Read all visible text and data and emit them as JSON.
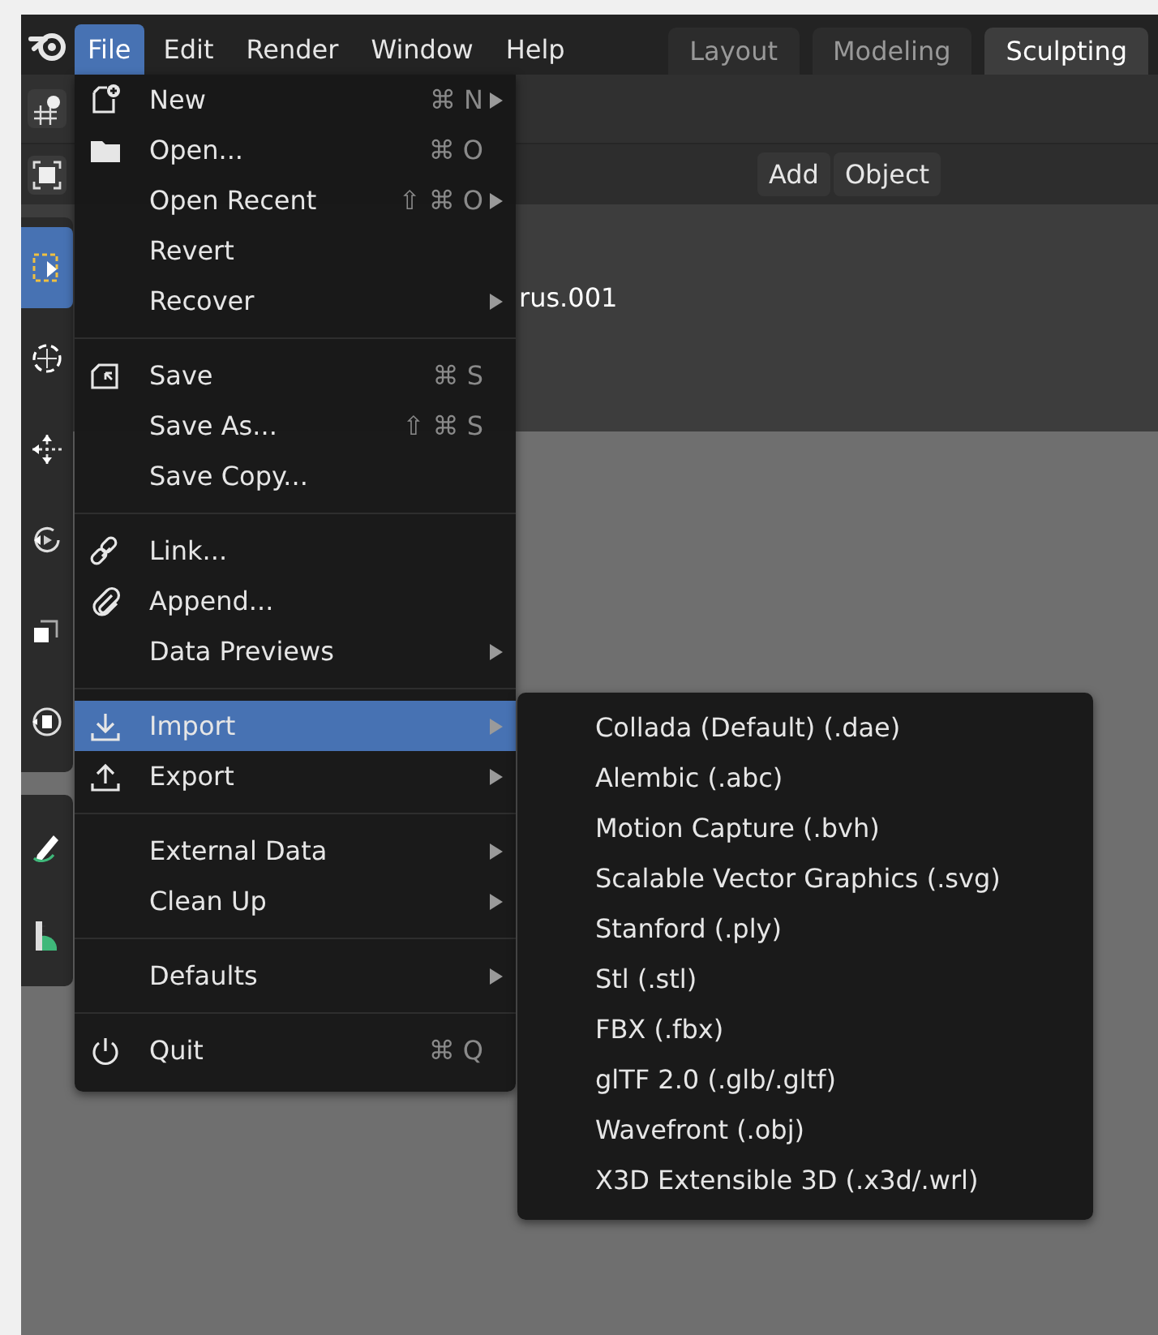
{
  "topbar": {
    "menus": [
      {
        "label": "File",
        "selected": true
      },
      {
        "label": "Edit",
        "selected": false
      },
      {
        "label": "Render",
        "selected": false
      },
      {
        "label": "Window",
        "selected": false
      },
      {
        "label": "Help",
        "selected": false
      }
    ],
    "workspace_tabs": [
      {
        "label": "Layout",
        "selected": false
      },
      {
        "label": "Modeling",
        "selected": false
      },
      {
        "label": "Sculpting",
        "selected": true
      }
    ]
  },
  "viewport_header": {
    "buttons": [
      "Add",
      "Object"
    ]
  },
  "viewport": {
    "overlay_text": "rus.001"
  },
  "toolbar": {
    "groups": [
      [
        {
          "selected": true
        },
        {
          "selected": false
        },
        {
          "selected": false
        },
        {
          "selected": false
        },
        {
          "selected": false
        },
        {
          "selected": false
        }
      ],
      [
        {
          "selected": false
        },
        {
          "selected": false
        }
      ]
    ]
  },
  "file_menu": {
    "items": [
      {
        "kind": "item",
        "label": "New",
        "shortcut": "⌘ N",
        "submenu": true,
        "selected": false
      },
      {
        "kind": "item",
        "label": "Open...",
        "shortcut": "⌘ O",
        "submenu": false,
        "selected": false
      },
      {
        "kind": "item",
        "label": "Open Recent",
        "shortcut": "⇧ ⌘ O",
        "submenu": true,
        "selected": false
      },
      {
        "kind": "item",
        "label": "Revert",
        "submenu": false,
        "selected": false
      },
      {
        "kind": "item",
        "label": "Recover",
        "submenu": true,
        "selected": false
      },
      {
        "kind": "separator"
      },
      {
        "kind": "item",
        "label": "Save",
        "shortcut": "⌘ S",
        "submenu": false,
        "selected": false
      },
      {
        "kind": "item",
        "label": "Save As...",
        "shortcut": "⇧ ⌘ S",
        "submenu": false,
        "selected": false
      },
      {
        "kind": "item",
        "label": "Save Copy...",
        "submenu": false,
        "selected": false
      },
      {
        "kind": "separator"
      },
      {
        "kind": "item",
        "label": "Link...",
        "submenu": false,
        "selected": false
      },
      {
        "kind": "item",
        "label": "Append...",
        "submenu": false,
        "selected": false
      },
      {
        "kind": "item",
        "label": "Data Previews",
        "submenu": true,
        "selected": false
      },
      {
        "kind": "separator"
      },
      {
        "kind": "item",
        "label": "Import",
        "submenu": true,
        "selected": true
      },
      {
        "kind": "item",
        "label": "Export",
        "submenu": true,
        "selected": false
      },
      {
        "kind": "separator"
      },
      {
        "kind": "item",
        "label": "External Data",
        "submenu": true,
        "selected": false
      },
      {
        "kind": "item",
        "label": "Clean Up",
        "submenu": true,
        "selected": false
      },
      {
        "kind": "separator"
      },
      {
        "kind": "item",
        "label": "Defaults",
        "submenu": true,
        "selected": false
      },
      {
        "kind": "separator"
      },
      {
        "kind": "item",
        "label": "Quit",
        "shortcut": "⌘ Q",
        "submenu": false,
        "selected": false
      }
    ]
  },
  "import_submenu": {
    "items": [
      "Collada (Default) (.dae)",
      "Alembic (.abc)",
      "Motion Capture (.bvh)",
      "Scalable Vector Graphics (.svg)",
      "Stanford (.ply)",
      "Stl (.stl)",
      "FBX (.fbx)",
      "glTF 2.0 (.glb/.gltf)",
      "Wavefront (.obj)",
      "X3D Extensible 3D (.x3d/.wrl)"
    ]
  }
}
